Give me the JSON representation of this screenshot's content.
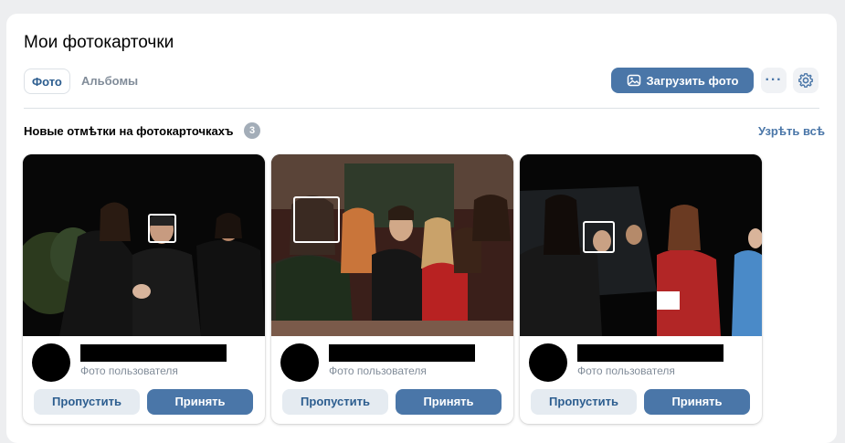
{
  "page": {
    "title": "Мои фотокарточки"
  },
  "tabs": [
    {
      "label": "Фото"
    },
    {
      "label": "Альбомы"
    }
  ],
  "toolbar": {
    "upload_label": "Загрузить фото",
    "more_label": "···",
    "upload_icon": "image-icon",
    "settings_icon": "gear-icon"
  },
  "section": {
    "title": "Новые отмѣтки на фотокарточкахъ",
    "count": "3",
    "show_all": "Узрѣть всѣ"
  },
  "cards": [
    {
      "subtitle": "Фото пользователя",
      "skip_label": "Пропустить",
      "accept_label": "Принять"
    },
    {
      "subtitle": "Фото пользователя",
      "skip_label": "Пропустить",
      "accept_label": "Принять"
    },
    {
      "subtitle": "Фото пользователя",
      "skip_label": "Пропустить",
      "accept_label": "Принять"
    }
  ],
  "colors": {
    "accent": "#4a76a8",
    "secondary_button": "#e5ebf1",
    "background": "#edeef0"
  }
}
